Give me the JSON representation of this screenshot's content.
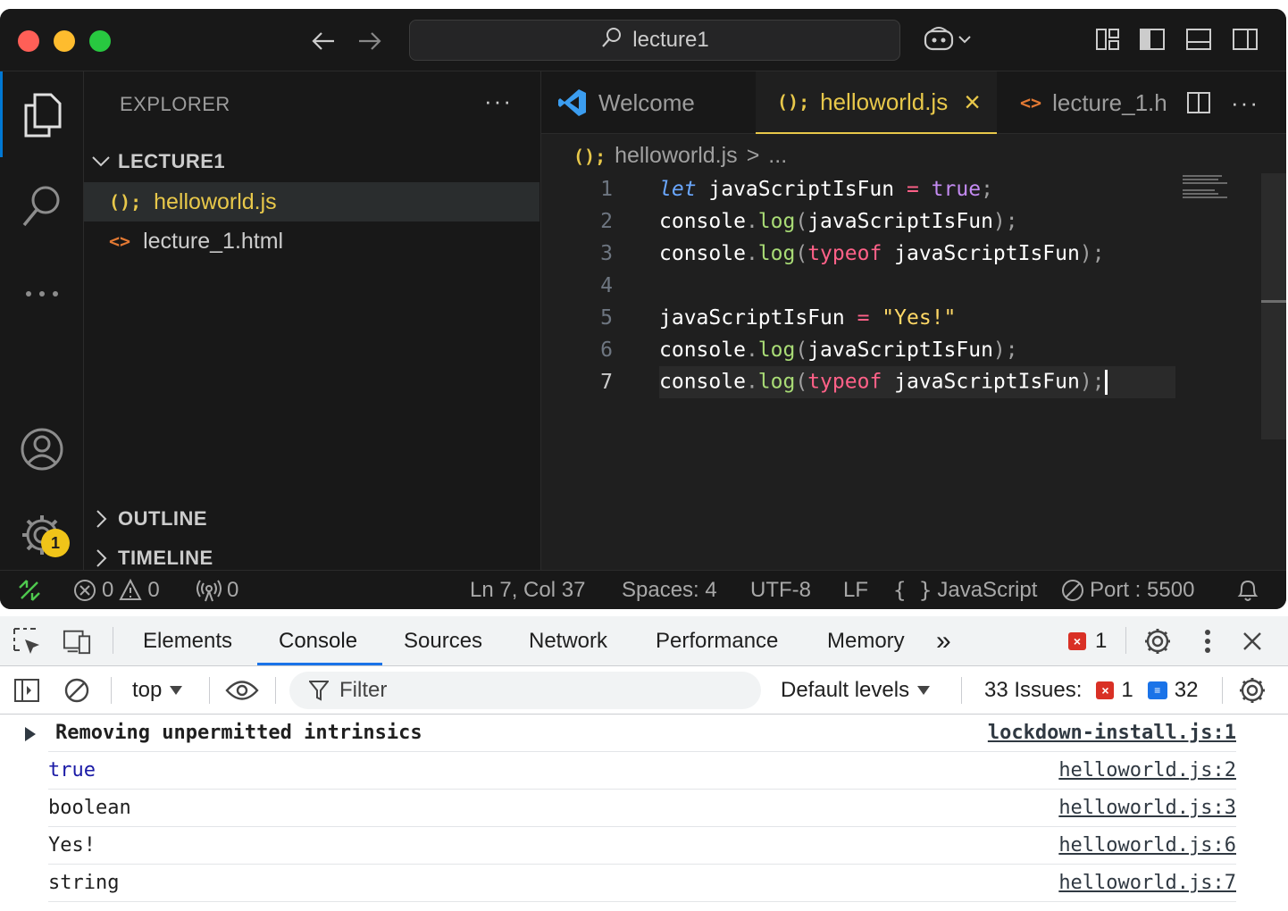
{
  "window": {
    "search_text": "lecture1"
  },
  "sidebar": {
    "title": "EXPLORER",
    "more": "···",
    "folder": "LECTURE1",
    "files": [
      {
        "icon": "(); ",
        "name": "helloworld.js"
      },
      {
        "icon": "<>",
        "name": "lecture_1.html"
      }
    ],
    "outline": "OUTLINE",
    "timeline": "TIMELINE",
    "settings_badge": "1"
  },
  "editor": {
    "tabs": [
      {
        "label": "Welcome"
      },
      {
        "label": "helloworld.js",
        "close": "×"
      },
      {
        "label": "lecture_1.h"
      }
    ],
    "tab_more": "···",
    "breadcrumb": {
      "file": "helloworld.js",
      "sep": ">",
      "rest": "..."
    },
    "line_numbers": [
      "1",
      "2",
      "3",
      "4",
      "5",
      "6",
      "7"
    ]
  },
  "statusbar": {
    "errors": "0",
    "warnings": "0",
    "ports": "0",
    "position": "Ln 7, Col 37",
    "spaces": "Spaces: 4",
    "encoding": "UTF-8",
    "eol": "LF",
    "language": "JavaScript",
    "port": "Port : 5500"
  },
  "devtools": {
    "tabs": [
      "Elements",
      "Console",
      "Sources",
      "Network",
      "Performance",
      "Memory"
    ],
    "more_tabs": "»",
    "error_count": "1",
    "context": "top",
    "filter_placeholder": "Filter",
    "levels": "Default levels",
    "issues_label": "33 Issues:",
    "issues_errors": "1",
    "issues_messages": "32",
    "console_rows": [
      {
        "value": "Removing unpermitted intrinsics",
        "source": "lockdown-install.js:1"
      },
      {
        "value": "true",
        "source": "helloworld.js:2"
      },
      {
        "value": "boolean",
        "source": "helloworld.js:3"
      },
      {
        "value": "Yes!",
        "source": "helloworld.js:6"
      },
      {
        "value": "string",
        "source": "helloworld.js:7"
      }
    ]
  },
  "colors": {
    "accent_blue": "#0078d4",
    "js_yellow": "#e8c84a",
    "html_orange": "#e37933"
  }
}
